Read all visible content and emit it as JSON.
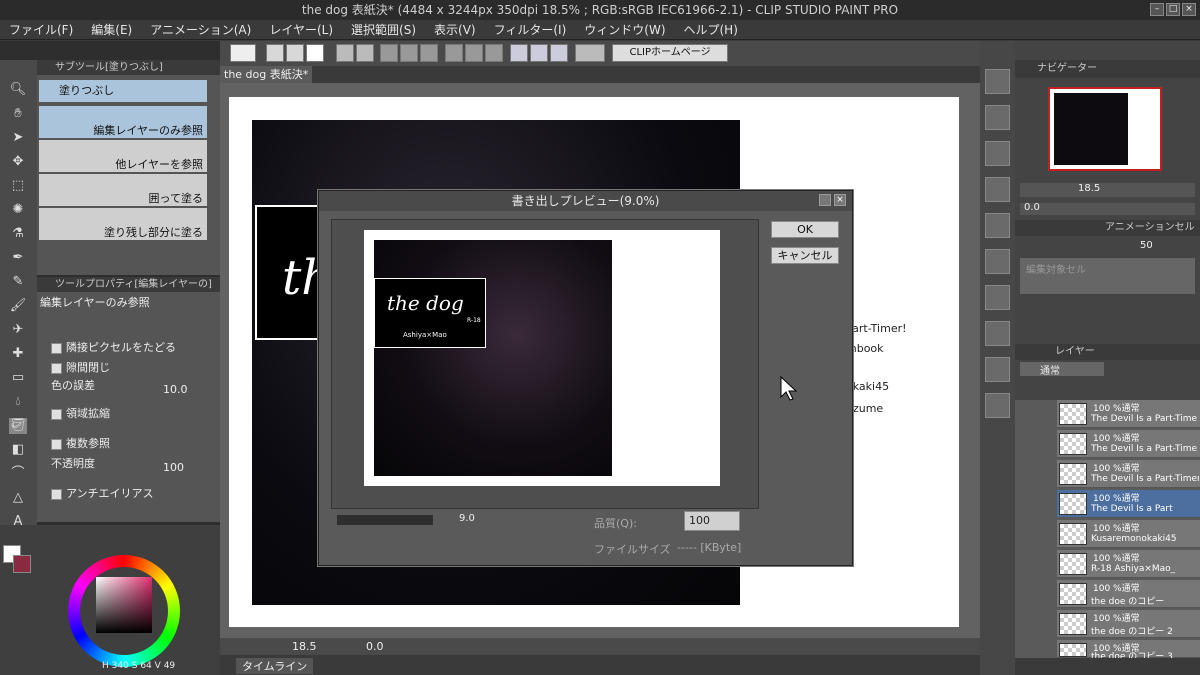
{
  "window": {
    "title": "the dog 表紙決* (4484 x 3244px 350dpi 18.5% ; RGB:sRGB IEC61966-2.1) - CLIP STUDIO PAINT PRO"
  },
  "menu": [
    "ファイル(F)",
    "編集(E)",
    "アニメーション(A)",
    "レイヤー(L)",
    "選択範囲(S)",
    "表示(V)",
    "フィルター(I)",
    "ウィンドウ(W)",
    "ヘルプ(H)"
  ],
  "command_bar": {
    "clip_home": "CLIPホームページ"
  },
  "document_tab": {
    "label": "the dog 表紙決*"
  },
  "subtool_panel": {
    "header": "サブツール[塗りつぶし]",
    "group": "塗りつぶし",
    "items": [
      "編集レイヤーのみ参照",
      "他レイヤーを参照",
      "囲って塗る",
      "塗り残し部分に塗る"
    ]
  },
  "tool_property": {
    "header": "ツールプロパティ[編集レイヤーの]",
    "title": "編集レイヤーのみ参照",
    "adjacent": "隣接ピクセルをたどる",
    "close_gap": "隙間閉じ",
    "color_margin": "色の誤差",
    "color_margin_value": "10.0",
    "expand": "領域拡縮",
    "multi_ref": "複数参照",
    "opacity": "不透明度",
    "opacity_value": "100",
    "antialias": "アンチエイリアス"
  },
  "color_panel": {
    "h_label": "H",
    "h": "340",
    "s_label": "S",
    "s": "64",
    "v_label": "V",
    "v": "49"
  },
  "canvas": {
    "cover_title": "the",
    "side_text": [
      "Part-Timer!",
      "mbook",
      "okaki45",
      "uzume"
    ]
  },
  "status_bar": {
    "zoom": "18.5",
    "angle": "0.0",
    "timeline": "タイムライン"
  },
  "dialog": {
    "title": "書き出しプレビュー(9.0%)",
    "ok": "OK",
    "cancel": "キャンセル",
    "preview_title": "the dog",
    "preview_rating": "R-18",
    "preview_author": "Ashiya×Mao",
    "zoom": "9.0",
    "quality_label": "品質(Q):",
    "quality_value": "100",
    "filesize_label": "ファイルサイズ",
    "filesize_value": "----- [KByte]"
  },
  "navigator": {
    "header": "ナビゲーター",
    "zoom": "18.5",
    "angle": "0.0"
  },
  "animation_cel": {
    "header": "アニメーションセル",
    "value": "50",
    "placeholder": "編集対象セル"
  },
  "layer_panel": {
    "header": "レイヤー",
    "blend": "通常",
    "layers": [
      {
        "line1": "100 %通常",
        "line2": "The Devil Is a Part-Time"
      },
      {
        "line1": "100 %通常",
        "line2": "The Devil Is a Part-Time"
      },
      {
        "line1": "100 %通常",
        "line2": "The Devil Is a Part-Timer"
      },
      {
        "line1": "100 %通常",
        "line2": "The Devil Is a Part"
      },
      {
        "line1": "100 %通常",
        "line2": "Kusaremonokaki45"
      },
      {
        "line1": "100 %通常",
        "line2": "R-18 Ashiya×Mao_"
      },
      {
        "line1": "100 %通常",
        "line2": "the doe のコピー"
      },
      {
        "line1": "100 %通常",
        "line2": "the doe のコピー 2"
      },
      {
        "line1": "100 %通常",
        "line2": "the doe のコピー 3"
      }
    ]
  }
}
